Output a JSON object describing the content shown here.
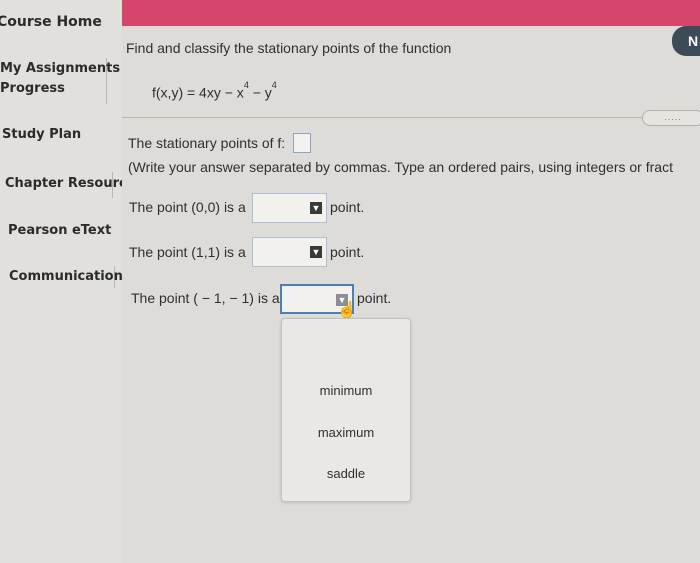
{
  "sidebar": {
    "course_home": "Course Home",
    "my_assignments": "My Assignments",
    "progress": "Progress",
    "study_plan": "Study Plan",
    "chapter_resources": "Chapter Resourc",
    "pearson_etext": "Pearson eText",
    "communication": "Communication"
  },
  "header": {
    "next_label": "N"
  },
  "question": {
    "prompt": "Find and classify the stationary points of the function",
    "function_base": "f(x,y) = 4xy − x",
    "exp1": "4",
    "function_mid": " − y",
    "exp2": "4",
    "more_label": ".....",
    "stationary_label": "The stationary points of f:",
    "instruction": "(Write your answer separated by commas. Type an ordered pairs, using integers or fract",
    "point1_prefix": "The point (0,0) is a",
    "point2_prefix": "The point (1,1) is a",
    "point3_prefix": "The point ( − 1, − 1) is a",
    "point_suffix": "point."
  },
  "dropdown": {
    "options": [
      "minimum",
      "maximum",
      "saddle"
    ]
  },
  "colors": {
    "header": "#d6466a",
    "select_border": "#4c7fb6"
  }
}
